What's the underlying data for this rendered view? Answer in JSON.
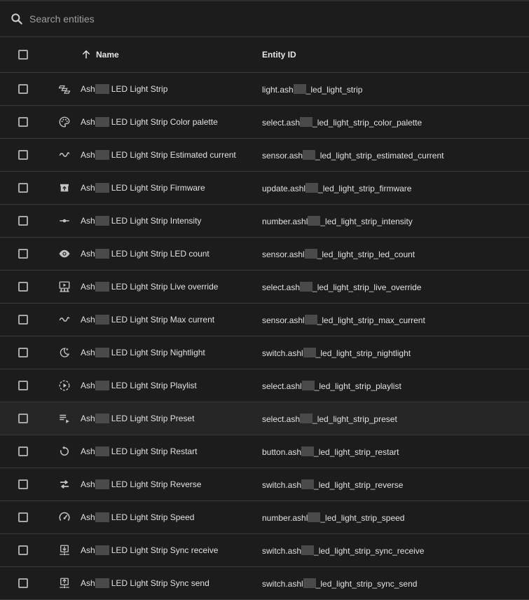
{
  "search": {
    "placeholder": "Search entities",
    "icon": "search-icon"
  },
  "table": {
    "columns": {
      "name": "Name",
      "entity_id": "Entity ID"
    },
    "sort": {
      "column": "name",
      "direction": "ascending",
      "icon": "arrow-up-icon"
    },
    "rows": [
      {
        "icon": "led-strip-icon",
        "name_prefix": "Ash",
        "name_suffix": "LED Light Strip",
        "id_prefix": "light.ash",
        "id_suffix": "_led_light_strip"
      },
      {
        "icon": "palette-icon",
        "name_prefix": "Ash",
        "name_suffix": "LED Light Strip Color palette",
        "id_prefix": "select.ash",
        "id_suffix": "_led_light_strip_color_palette"
      },
      {
        "icon": "sine-wave-icon",
        "name_prefix": "Ash",
        "name_suffix": "LED Light Strip Estimated current",
        "id_prefix": "sensor.ash",
        "id_suffix": "_led_light_strip_estimated_current"
      },
      {
        "icon": "package-up-icon",
        "name_prefix": "Ash",
        "name_suffix": "LED Light Strip Firmware",
        "id_prefix": "update.ashl",
        "id_suffix": "_led_light_strip_firmware"
      },
      {
        "icon": "slider-icon",
        "name_prefix": "Ash",
        "name_suffix": "LED Light Strip Intensity",
        "id_prefix": "number.ashl",
        "id_suffix": "_led_light_strip_intensity"
      },
      {
        "icon": "eye-icon",
        "name_prefix": "Ash",
        "name_suffix": "LED Light Strip LED count",
        "id_prefix": "sensor.ashl",
        "id_suffix": "_led_light_strip_led_count"
      },
      {
        "icon": "presentation-icon",
        "name_prefix": "Ash",
        "name_suffix": "LED Light Strip Live override",
        "id_prefix": "select.ash",
        "id_suffix": "_led_light_strip_live_override"
      },
      {
        "icon": "sine-wave-icon",
        "name_prefix": "Ash",
        "name_suffix": "LED Light Strip Max current",
        "id_prefix": "sensor.ashl",
        "id_suffix": "_led_light_strip_max_current"
      },
      {
        "icon": "moon-star-icon",
        "name_prefix": "Ash",
        "name_suffix": "LED Light Strip Nightlight",
        "id_prefix": "switch.ashl",
        "id_suffix": "_led_light_strip_nightlight"
      },
      {
        "icon": "play-circle-icon",
        "name_prefix": "Ash",
        "name_suffix": "LED Light Strip Playlist",
        "id_prefix": "select.ashl",
        "id_suffix": "_led_light_strip_playlist"
      },
      {
        "icon": "playlist-play-icon",
        "name_prefix": "Ash",
        "name_suffix": "LED Light Strip Preset",
        "id_prefix": "select.ash",
        "id_suffix": "_led_light_strip_preset"
      },
      {
        "icon": "restart-icon",
        "name_prefix": "Ash",
        "name_suffix": "LED Light Strip Restart",
        "id_prefix": "button.ash",
        "id_suffix": "_led_light_strip_restart"
      },
      {
        "icon": "swap-icon",
        "name_prefix": "Ash",
        "name_suffix": "LED Light Strip Reverse",
        "id_prefix": "switch.ash",
        "id_suffix": "_led_light_strip_reverse"
      },
      {
        "icon": "speedometer-icon",
        "name_prefix": "Ash",
        "name_suffix": "LED Light Strip Speed",
        "id_prefix": "number.ashl",
        "id_suffix": "_led_light_strip_speed"
      },
      {
        "icon": "download-network-icon",
        "name_prefix": "Ash",
        "name_suffix": "LED Light Strip Sync receive",
        "id_prefix": "switch.ash",
        "id_suffix": "_led_light_strip_sync_receive"
      },
      {
        "icon": "upload-network-icon",
        "name_prefix": "Ash",
        "name_suffix": "LED Light Strip Sync send",
        "id_prefix": "switch.ashl",
        "id_suffix": "_led_light_strip_sync_send"
      }
    ]
  },
  "colors": {
    "background": "#1c1c1c",
    "divider": "#3a3a3a",
    "text": "#e1e1e1",
    "hover_row": "#262626"
  }
}
